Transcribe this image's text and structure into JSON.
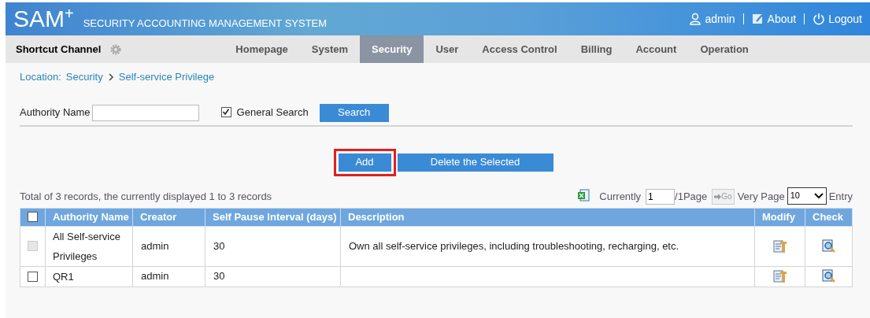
{
  "header": {
    "logo": "SAM",
    "logo_sup": "+",
    "system_name": "SECURITY ACCOUNTING MANAGEMENT SYSTEM",
    "user": "admin",
    "about": "About",
    "logout": "Logout"
  },
  "nav": {
    "shortcut": "Shortcut Channel",
    "tabs": [
      {
        "label": "Homepage",
        "selected": false
      },
      {
        "label": "System",
        "selected": false
      },
      {
        "label": "Security",
        "selected": true
      },
      {
        "label": "User",
        "selected": false
      },
      {
        "label": "Access Control",
        "selected": false
      },
      {
        "label": "Billing",
        "selected": false
      },
      {
        "label": "Account",
        "selected": false
      },
      {
        "label": "Operation",
        "selected": false
      }
    ]
  },
  "breadcrumb": {
    "label": "Location:",
    "items": [
      "Security",
      "Self-service Privilege"
    ]
  },
  "search": {
    "field_label": "Authority Name",
    "general_search": {
      "label": "General Search",
      "checked": true
    },
    "button": "Search"
  },
  "actions": [
    {
      "label": "Add",
      "highlighted": true
    },
    {
      "label": "Delete the Selected",
      "highlighted": false
    }
  ],
  "summary": "Total of 3 records, the currently displayed 1 to 3 records",
  "pager": {
    "currently": "Currently",
    "page": "1",
    "of_pages": "/1Page",
    "go": "Go",
    "per_page_label": "Very Page",
    "per_page": "10",
    "entry": "Entry"
  },
  "table": {
    "all_checked": false,
    "columns": [
      "Authority Name",
      "Creator",
      "Self Pause Interval (days)",
      "Description",
      "Modify",
      "Check"
    ],
    "rows": [
      {
        "checked": false,
        "disabled": true,
        "name": "All Self-service Privileges",
        "creator": "admin",
        "interval": "30",
        "description": "Own all self-service privileges, including troubleshooting, recharging, etc."
      },
      {
        "checked": false,
        "disabled": false,
        "name": "QR1",
        "creator": "admin",
        "interval": "30"
      }
    ]
  }
}
